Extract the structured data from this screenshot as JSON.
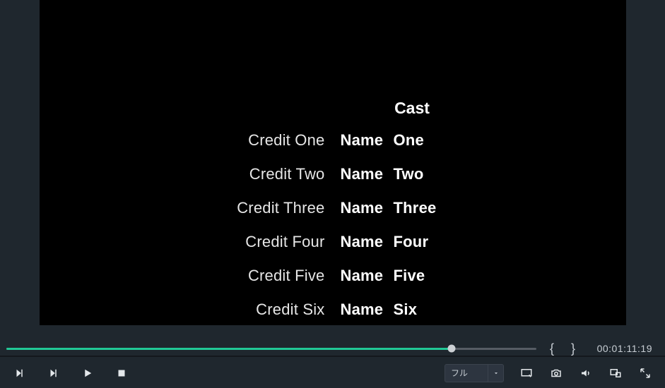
{
  "credits": {
    "title": "Cast",
    "rows": [
      {
        "role": "Credit One",
        "name": "Name One"
      },
      {
        "role": "Credit Two",
        "name": "Name Two"
      },
      {
        "role": "Credit Three",
        "name": "Name Three"
      },
      {
        "role": "Credit Four",
        "name": "Name Four"
      },
      {
        "role": "Credit Five",
        "name": "Name Five"
      },
      {
        "role": "Credit Six",
        "name": "Name Six"
      }
    ]
  },
  "timeline": {
    "progress_pct": 84,
    "brace_in": "{",
    "brace_out": "}",
    "timecode": "00:01:11:19"
  },
  "controls": {
    "quality_label": "フル"
  }
}
